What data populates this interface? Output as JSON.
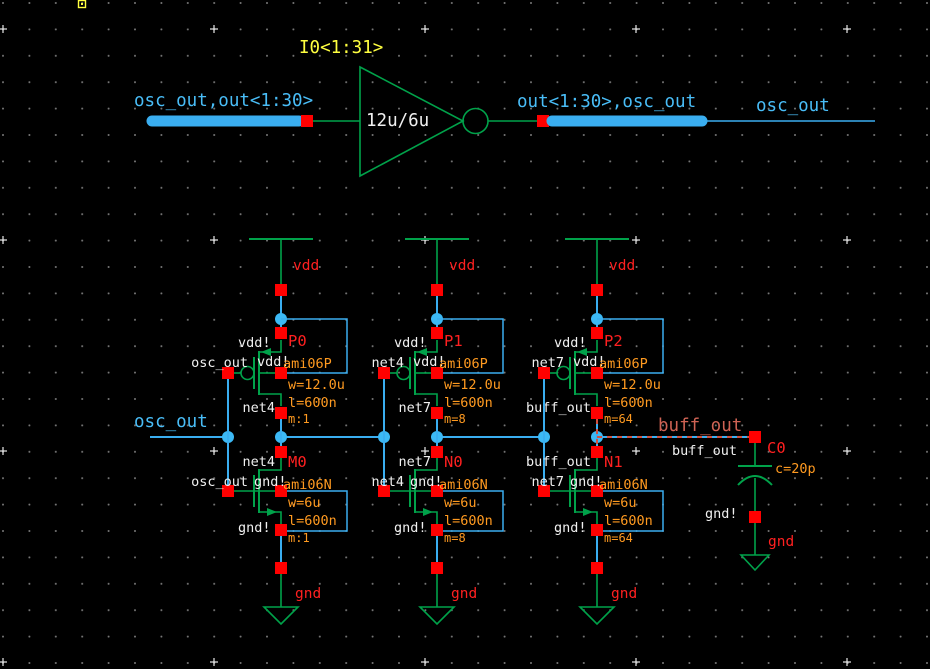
{
  "colors": {
    "wire": "#3aaef0",
    "junction": "#3cb9f5",
    "symbol_green": "#00a24a",
    "pin_red": "#ff0000",
    "label_red": "#ff2020",
    "param_orange": "#ff9a20",
    "net_white": "#f0f0f0",
    "bus_cyan": "#49bdf7",
    "id_yellow": "#ffff40",
    "highlight_salmon": "#cf6354",
    "highlight_dash": "#d05040",
    "grid_dot": "#7a7a7a"
  },
  "top_row": {
    "instance_name": "I0<1:31>",
    "device_size": "12u/6u",
    "input_bus": "osc_out,out<1:30>",
    "output_bus": "out<1:30>,osc_out",
    "output_net": "osc_out"
  },
  "input_net": "osc_out",
  "stages": [
    {
      "vdd": "vdd",
      "gnd": "gnd",
      "pmos": {
        "name": "P0",
        "model": "ami06P",
        "w": "w=12.0u",
        "l": "l=600n",
        "m": "m:1",
        "gate": "osc_out",
        "drain": "net4",
        "bulk": "vdd!",
        "source": "vdd!"
      },
      "nmos": {
        "name": "M0",
        "model": "ami06N",
        "w": "w=6u",
        "l": "l=600n",
        "m": "m:1",
        "gate": "osc_out",
        "drain": "net4",
        "bulk": "gnd!",
        "source": "gnd!"
      }
    },
    {
      "vdd": "vdd",
      "gnd": "gnd",
      "pmos": {
        "name": "P1",
        "model": "ami06P",
        "w": "w=12.0u",
        "l": "l=600n",
        "m": "m=8",
        "gate": "net4",
        "drain": "net7",
        "bulk": "vdd!",
        "source": "vdd!"
      },
      "nmos": {
        "name": "N0",
        "model": "ami06N",
        "w": "w=6u",
        "l": "l=600n",
        "m": "m=8",
        "gate": "net4",
        "drain": "net7",
        "bulk": "gnd!",
        "source": "gnd!"
      }
    },
    {
      "vdd": "vdd",
      "gnd": "gnd",
      "pmos": {
        "name": "P2",
        "model": "ami06P",
        "w": "w=12.0u",
        "l": "l=600n",
        "m": "m=64",
        "gate": "net7",
        "drain": "buff_out",
        "bulk": "vdd!",
        "source": "vdd!"
      },
      "nmos": {
        "name": "N1",
        "model": "ami06N",
        "w": "w=6u",
        "l": "l=600n",
        "m": "m=64",
        "gate": "net7",
        "drain": "buff_out",
        "bulk": "gnd!",
        "source": "gnd!"
      }
    }
  ],
  "load": {
    "highlight_net": "buff_out",
    "net": "buff_out",
    "name": "C0",
    "value": "c=20p",
    "bottom_net": "gnd!",
    "gnd": "gnd"
  }
}
